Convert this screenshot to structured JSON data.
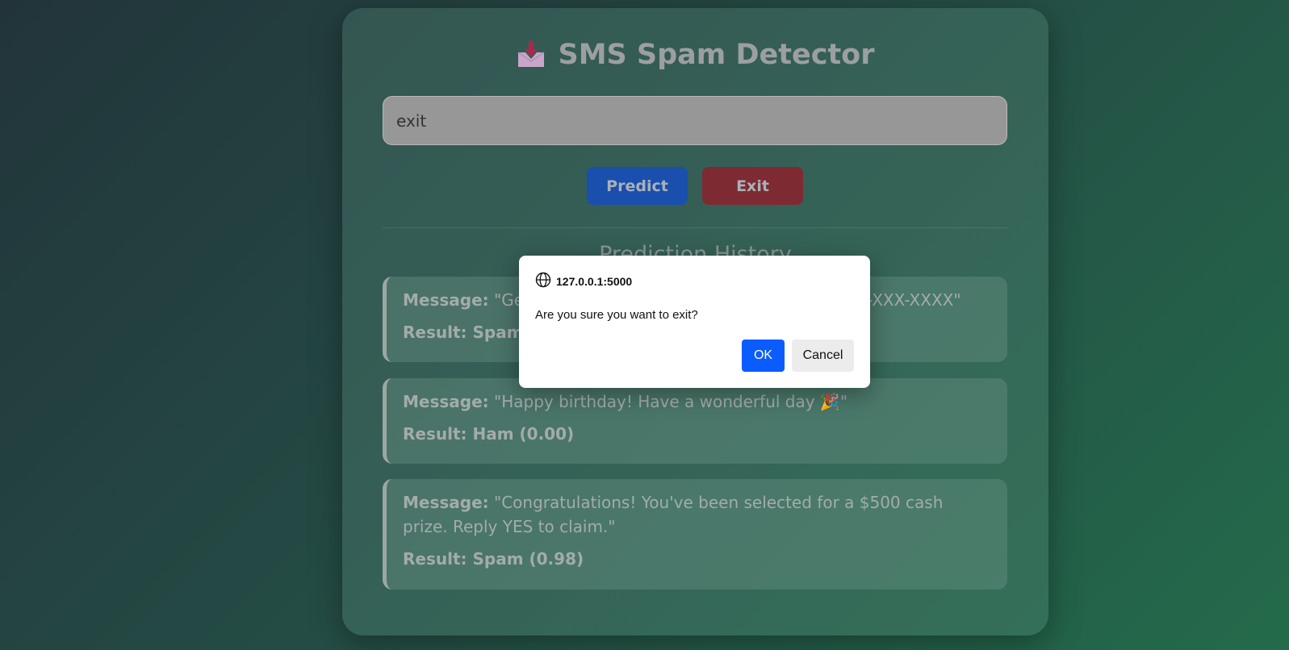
{
  "app": {
    "title": "SMS Spam Detector",
    "title_icon": "inbox-tray-icon"
  },
  "input": {
    "value": "exit"
  },
  "buttons": {
    "predict": "Predict",
    "exit": "Exit"
  },
  "history": {
    "title": "Prediction History",
    "message_label": "Message:",
    "items": [
      {
        "message": "\"Get ... -XXX-XXXX\"",
        "message_visible_start": "\"Get",
        "message_visible_end": "-XXX-XXXX\"",
        "result": "Result: Spam ("
      },
      {
        "message": "\"Happy birthday! Have a wonderful day 🎉\"",
        "result": "Result: Ham (0.00)"
      },
      {
        "message": "\"Congratulations! You've been selected for a $500 cash prize. Reply YES to claim.\"",
        "result": "Result: Spam (0.98)"
      }
    ]
  },
  "dialog": {
    "origin": "127.0.0.1:5000",
    "origin_icon": "globe-icon",
    "question": "Are you sure you want to exit?",
    "ok": "OK",
    "cancel": "Cancel"
  },
  "colors": {
    "predict": "#1a4fae",
    "exit": "#7e2a33",
    "ok": "#0b5cff"
  }
}
